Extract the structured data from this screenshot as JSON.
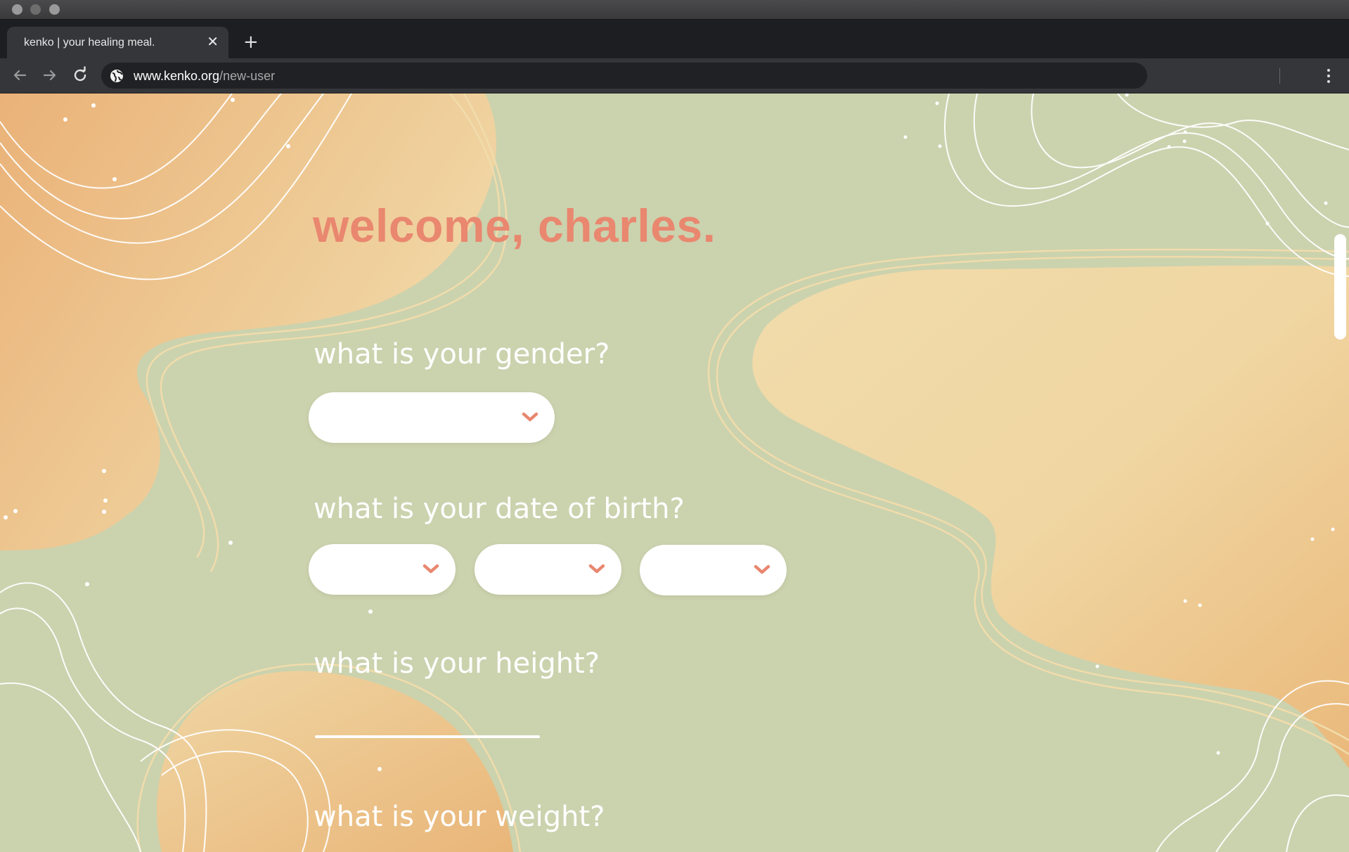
{
  "browser": {
    "tab_title": "kenko | your healing meal.",
    "tab_close": "✕",
    "new_tab": "+",
    "url_host": "www.kenko.org",
    "url_path": "/new-user"
  },
  "page": {
    "welcome": "welcome, charles.",
    "questions": {
      "gender": "what is your gender?",
      "dob": "what is your date of birth?",
      "height": "what is your height?",
      "weight": "what is your weight?"
    }
  },
  "colors": {
    "background": "#cbd2ae",
    "accent": "#e9876f",
    "blob_light": "#f1dcac",
    "blob_dark": "#eab97b"
  },
  "icons": {
    "back": "arrow-left-icon",
    "forward": "arrow-right-icon",
    "reload": "reload-icon",
    "site_info": "globe-icon",
    "menu": "kebab-menu-icon",
    "dropdown": "chevron-down-icon"
  }
}
